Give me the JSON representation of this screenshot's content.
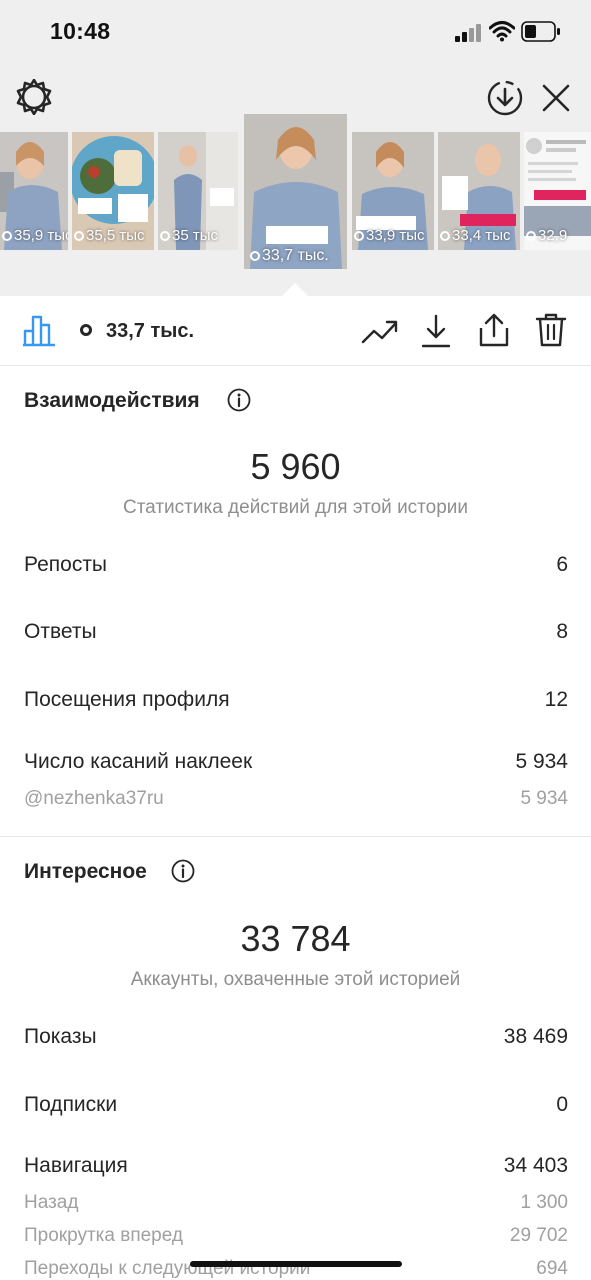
{
  "status_bar": {
    "time": "10:48"
  },
  "stories": [
    {
      "views": "35,9 тыс"
    },
    {
      "views": "35,5 тыс"
    },
    {
      "views": "35 тыс"
    },
    {
      "views": "33,7 тыс."
    },
    {
      "views": "33,9 тыс"
    },
    {
      "views": "33,4 тыс"
    },
    {
      "views": "32,9"
    }
  ],
  "toolbar": {
    "views": "33,7 тыс."
  },
  "interactions": {
    "title": "Взаимодействия",
    "total": "5 960",
    "subtitle": "Статистика действий для этой истории",
    "rows": [
      {
        "label": "Репосты",
        "value": "6"
      },
      {
        "label": "Ответы",
        "value": "8"
      },
      {
        "label": "Посещения профиля",
        "value": "12"
      },
      {
        "label": "Число касаний наклеек",
        "value": "5 934"
      }
    ],
    "sub_rows": [
      {
        "label": "@nezhenka37ru",
        "value": "5 934"
      }
    ]
  },
  "discovery": {
    "title": "Интересное",
    "total": "33 784",
    "subtitle": "Аккаунты, охваченные этой историей",
    "rows": [
      {
        "label": "Показы",
        "value": "38 469"
      },
      {
        "label": "Подписки",
        "value": "0"
      },
      {
        "label": "Навигация",
        "value": "34 403"
      }
    ],
    "sub_rows": [
      {
        "label": "Назад",
        "value": "1 300"
      },
      {
        "label": "Прокрутка вперед",
        "value": "29 702"
      },
      {
        "label": "Переходы к следующей истории",
        "value": "694"
      }
    ]
  },
  "colors": {
    "accent": "#3897f0",
    "text": "#262626",
    "muted": "#8e8e8e",
    "header_bg": "#efefef"
  }
}
